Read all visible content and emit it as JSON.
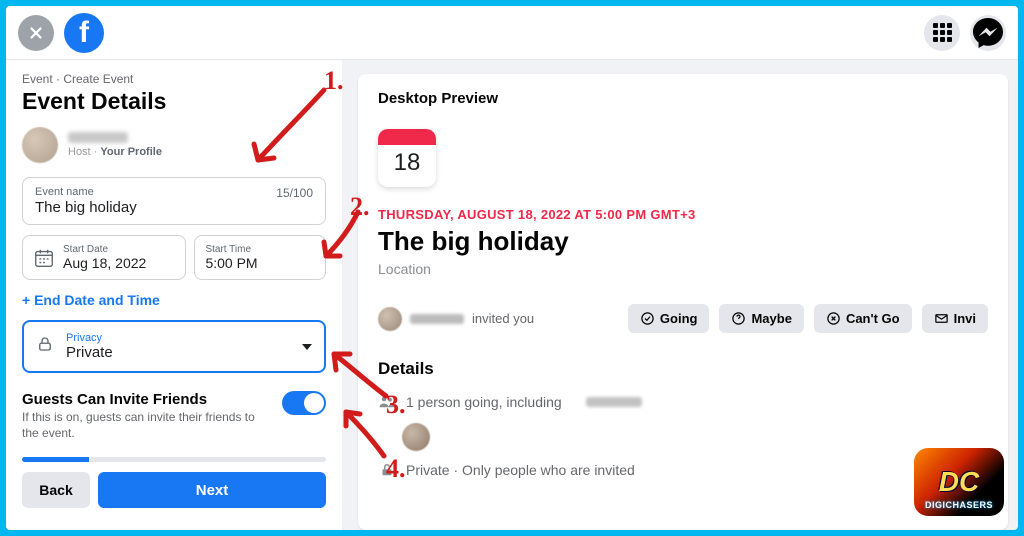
{
  "breadcrumb": "Event · Create Event",
  "pageTitle": "Event Details",
  "host": {
    "subPrefix": "Host · ",
    "subMain": "Your Profile"
  },
  "eventName": {
    "label": "Event name",
    "value": "The big holiday",
    "count": "15/100"
  },
  "startDate": {
    "label": "Start Date",
    "value": "Aug 18, 2022"
  },
  "startTime": {
    "label": "Start Time",
    "value": "5:00 PM"
  },
  "addEnd": "+ End Date and Time",
  "privacy": {
    "label": "Privacy",
    "value": "Private"
  },
  "inviteFriends": {
    "title": "Guests Can Invite Friends",
    "desc": "If this is on, guests can invite their friends to the event."
  },
  "buttons": {
    "back": "Back",
    "next": "Next"
  },
  "preview": {
    "label": "Desktop Preview",
    "day": "18",
    "dateLine": "THURSDAY, AUGUST 18, 2022 AT 5:00 PM GMT+3",
    "title": "The big holiday",
    "location": "Location",
    "invitedYou": "invited you",
    "rsvp": {
      "going": "Going",
      "maybe": "Maybe",
      "cant": "Can't Go",
      "invite": "Invi"
    },
    "detailsTitle": "Details",
    "goingLine": "1 person going, including",
    "privacyLine": "Private · Only people who are invited"
  },
  "annotations": {
    "a1": "1.",
    "a2": "2.",
    "a3": "3.",
    "a4": "4."
  },
  "watermark": "DIGICHASERS"
}
